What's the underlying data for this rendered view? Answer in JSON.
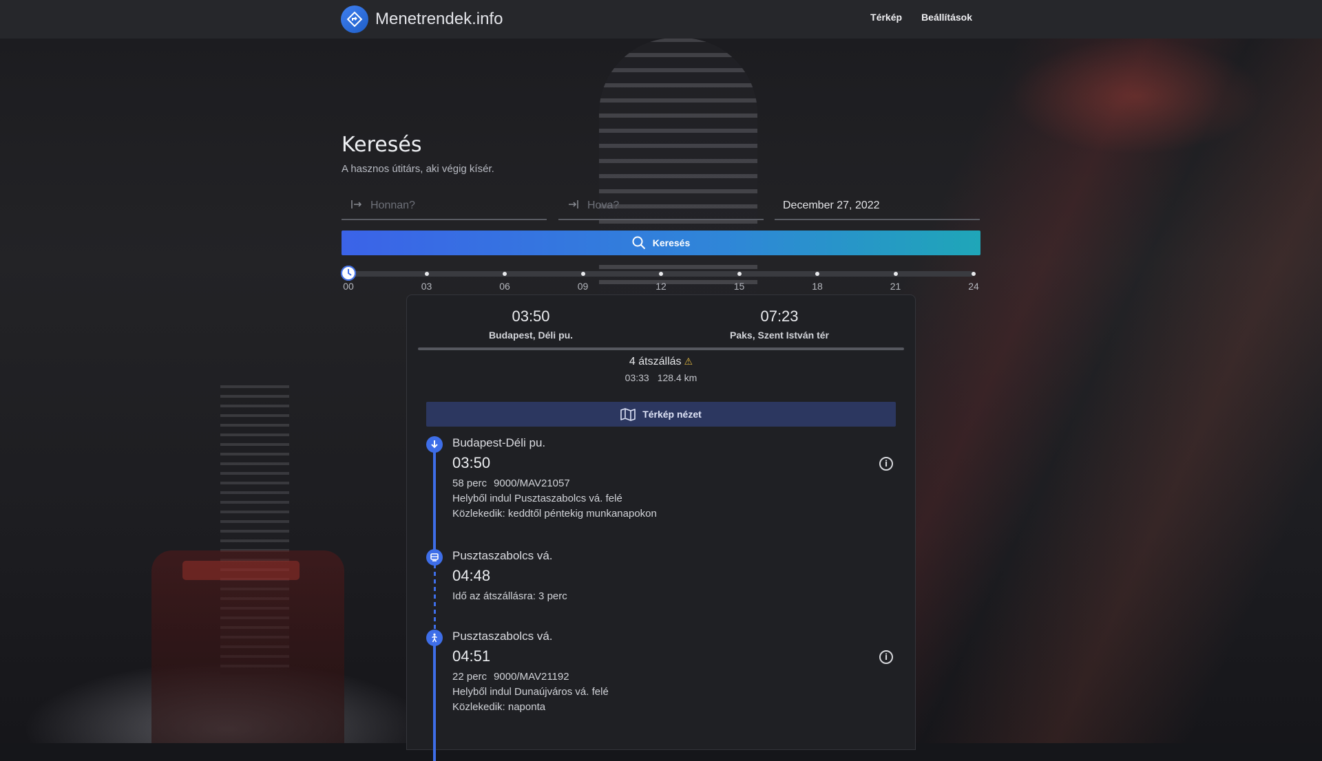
{
  "header": {
    "site_title": "Menetrendek.info",
    "nav": [
      "Térkép",
      "Beállítások"
    ]
  },
  "search": {
    "title": "Keresés",
    "subtitle": "A hasznos útitárs, aki végig kísér.",
    "from_placeholder": "Honnan?",
    "to_placeholder": "Hova?",
    "date": "December 27, 2022",
    "button_label": "Keresés"
  },
  "time_slider": {
    "value_hour": 0,
    "labels": [
      "00",
      "03",
      "06",
      "09",
      "12",
      "15",
      "18",
      "21",
      "24"
    ]
  },
  "result": {
    "departure": {
      "time": "03:50",
      "place": "Budapest, Déli pu."
    },
    "arrival": {
      "time": "07:23",
      "place": "Paks, Szent István tér"
    },
    "transfers": "4 átszállás",
    "duration": "03:33",
    "distance": "128.4 km",
    "map_button": "Térkép nézet",
    "stops": [
      {
        "name": "Budapest-Déli pu.",
        "time": "03:50",
        "duration": "58 perc",
        "route": "9000/MAV21057",
        "direction": "Helyből indul Pusztaszabolcs vá. felé",
        "runs": "Közlekedik: keddtől péntekig munkanapokon",
        "icon": "train-departure-icon"
      },
      {
        "name": "Pusztaszabolcs vá.",
        "time": "04:48",
        "transfer_time": "Idő az átszállásra: 3 perc",
        "icon": "bus-stop-icon"
      },
      {
        "name": "Pusztaszabolcs vá.",
        "time": "04:51",
        "duration": "22 perc",
        "route": "9000/MAV21192",
        "direction": "Helyből indul Dunaújváros vá. felé",
        "runs": "Közlekedik: naponta",
        "icon": "walking-person-icon"
      }
    ]
  },
  "colors": {
    "accent": "#3e6ee8",
    "search_gradient_start": "#3b63e8",
    "search_gradient_end": "#1fa6b8",
    "warning": "#e0b640",
    "card_bg": "#1f2024",
    "header_bg": "#26272b"
  }
}
